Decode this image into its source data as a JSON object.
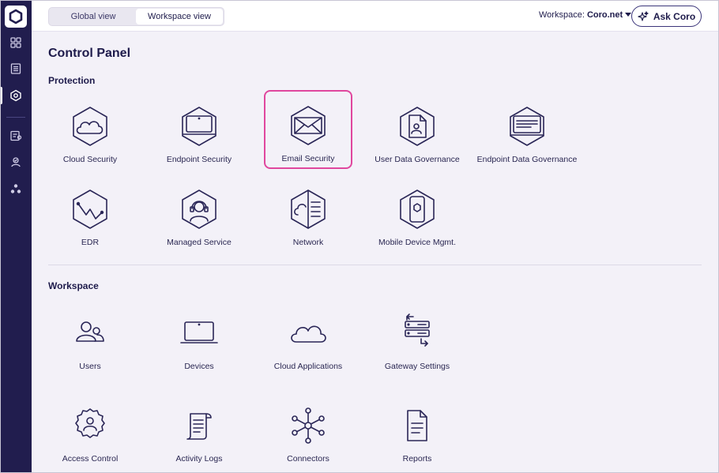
{
  "topbar": {
    "view_toggle": {
      "global": "Global view",
      "workspace": "Workspace view"
    },
    "workspace_label": "Workspace:",
    "workspace_value": "Coro.net",
    "ask_button": "Ask Coro"
  },
  "sidebar": {
    "items": [
      {
        "icon": "dashboard-grid-icon"
      },
      {
        "icon": "list-icon"
      },
      {
        "icon": "control-panel-icon",
        "active": true
      },
      {
        "icon": "tickets-icon"
      },
      {
        "icon": "user-shield-icon"
      },
      {
        "icon": "connectors-icon"
      }
    ]
  },
  "page": {
    "title": "Control Panel",
    "protection_title": "Protection",
    "workspace_title": "Workspace"
  },
  "protection": [
    {
      "label": "Cloud Security"
    },
    {
      "label": "Endpoint Security"
    },
    {
      "label": "Email Security",
      "selected": true
    },
    {
      "label": "User Data Governance"
    },
    {
      "label": "Endpoint Data Governance"
    },
    {
      "label": "EDR"
    },
    {
      "label": "Managed Service"
    },
    {
      "label": "Network"
    },
    {
      "label": "Mobile Device Mgmt."
    }
  ],
  "workspace": [
    {
      "label": "Users"
    },
    {
      "label": "Devices"
    },
    {
      "label": "Cloud Applications"
    },
    {
      "label": "Gateway Settings"
    },
    {
      "label": "Access Control"
    },
    {
      "label": "Activity Logs"
    },
    {
      "label": "Connectors"
    },
    {
      "label": "Reports"
    }
  ],
  "colors": {
    "sidebar": "#211d4e",
    "accent": "#e0479e",
    "background": "#f3f1f8"
  }
}
